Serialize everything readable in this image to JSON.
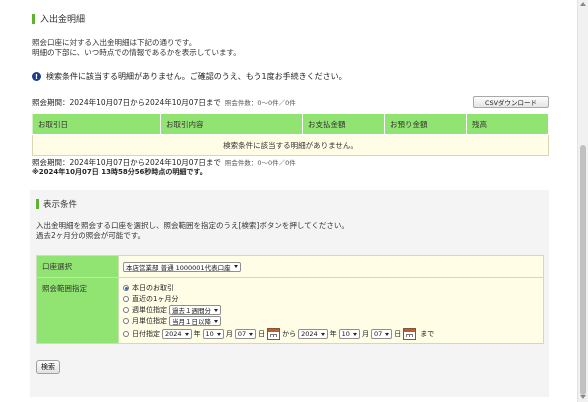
{
  "heading": "入出金明細",
  "intro": [
    "照会口座に対する入出金明細は下記の通りです。",
    "明細の下部に、いつ時点での情報であるかを表示しています。"
  ],
  "notice": "検索条件に該当する明細がありません。ご確認のうえ、もう1度お手続きください。",
  "period_label": "照会期間：2024年10月07日から2024年10月07日まで",
  "count_label": "照会件数：0～0件／0件",
  "csv_button": "CSVダウンロード",
  "table": {
    "headers": [
      "お取引日",
      "お取引内容",
      "お支払金額",
      "お預り金額",
      "残高"
    ],
    "empty_message": "検索条件に該当する明細がありません。"
  },
  "timestamp": "※2024年10月07日 13時58分56秒時点の明細です。",
  "conditions": {
    "title": "表示条件",
    "desc": [
      "入出金明細を照会する口座を選択し、照会範囲を指定のうえ[検索]ボタンを押してください。",
      "過去2ヶ月分の照会が可能です。"
    ],
    "account_label": "口座選択",
    "account_value": "本店営業部 普通 1000001代表口座",
    "range_label": "照会範囲指定",
    "options": {
      "today": "本日のお取引",
      "last_month": "直近の1ヶ月分",
      "weekly": "週単位指定",
      "weekly_value": "過去１週間分",
      "monthly": "月単位指定",
      "monthly_value": "当月１日以降",
      "date": "日付指定"
    },
    "from": {
      "year": "2024",
      "month": "10",
      "day": "07"
    },
    "to": {
      "year": "2024",
      "month": "10",
      "day": "07"
    },
    "unit_year": "年",
    "unit_month": "月",
    "unit_day": "日",
    "kara": "から",
    "made": "まで",
    "search_button": "検索"
  }
}
